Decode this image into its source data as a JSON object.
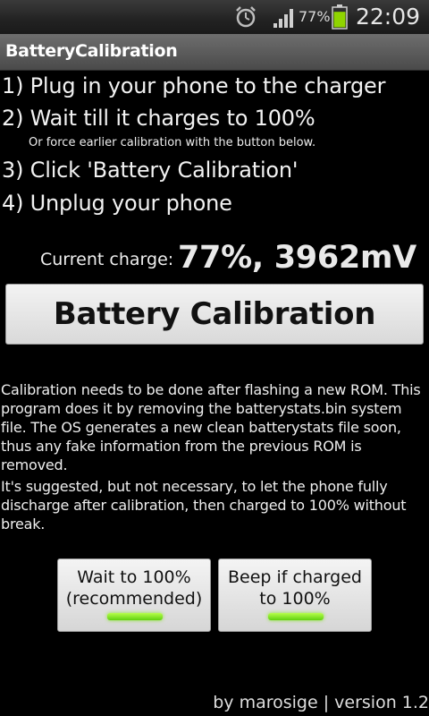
{
  "status_bar": {
    "battery_percent": "77%",
    "time": "22:09",
    "battery_level": 0.77,
    "icons": [
      "alarm-icon",
      "signal-icon",
      "battery-icon"
    ]
  },
  "app": {
    "title": "BatteryCalibration"
  },
  "steps": [
    "1) Plug in your phone to the charger",
    "2) Wait till it charges to 100%",
    "3) Click 'Battery Calibration'",
    "4) Unplug your phone"
  ],
  "substep_note": "Or force earlier calibration with the button below.",
  "charge": {
    "label": "Current charge:",
    "value": "77%, 3962mV"
  },
  "calibrate_button": {
    "label": "Battery Calibration"
  },
  "description": [
    "Calibration needs to be done after flashing a new ROM. This program does it by removing the batterystats.bin system file. The OS generates a new clean batterystats file soon, thus any fake information from the previous ROM is removed.",
    "It's suggested, but not necessary, to let the phone fully discharge after calibration, then charged to 100% without break."
  ],
  "toggles": [
    {
      "line1": "Wait to 100%",
      "line2": "(recommended)",
      "on": true
    },
    {
      "line1": "Beep if charged",
      "line2": "to 100%",
      "on": true
    }
  ],
  "footer": "by marosige | version 1.2",
  "colors": {
    "background": "#000000",
    "indicator_on": "#7fe021",
    "battery_fill": "#8fd400"
  }
}
